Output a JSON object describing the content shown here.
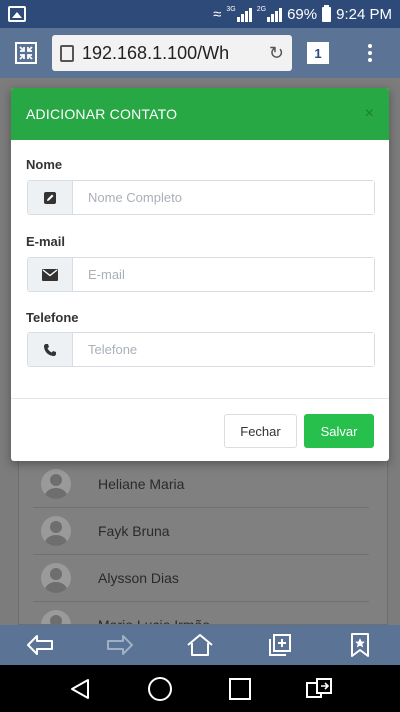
{
  "status_bar": {
    "signal_tag_1": "3G",
    "signal_tag_2": "2G",
    "battery": "69%",
    "time": "9:24 PM"
  },
  "browser": {
    "url": "192.168.1.100/Wh",
    "tab_count": "1"
  },
  "modal": {
    "title": "ADICIONAR CONTATO",
    "close_symbol": "×",
    "fields": [
      {
        "label": "Nome",
        "placeholder": "Nome Completo",
        "icon": "edit-icon"
      },
      {
        "label": "E-mail",
        "placeholder": "E-mail",
        "icon": "envelope-icon"
      },
      {
        "label": "Telefone",
        "placeholder": "Telefone",
        "icon": "phone-icon"
      }
    ],
    "close_label": "Fechar",
    "save_label": "Salvar"
  },
  "contacts": [
    {
      "name": "Heliane Maria"
    },
    {
      "name": "Fayk Bruna"
    },
    {
      "name": "Alysson Dias"
    },
    {
      "name": "Mario Lucio Irmão"
    }
  ],
  "colors": {
    "header_green": "#28a745",
    "save_green": "#28c04d",
    "browser_blue": "#5b7394",
    "status_blue": "#2e4a78"
  }
}
